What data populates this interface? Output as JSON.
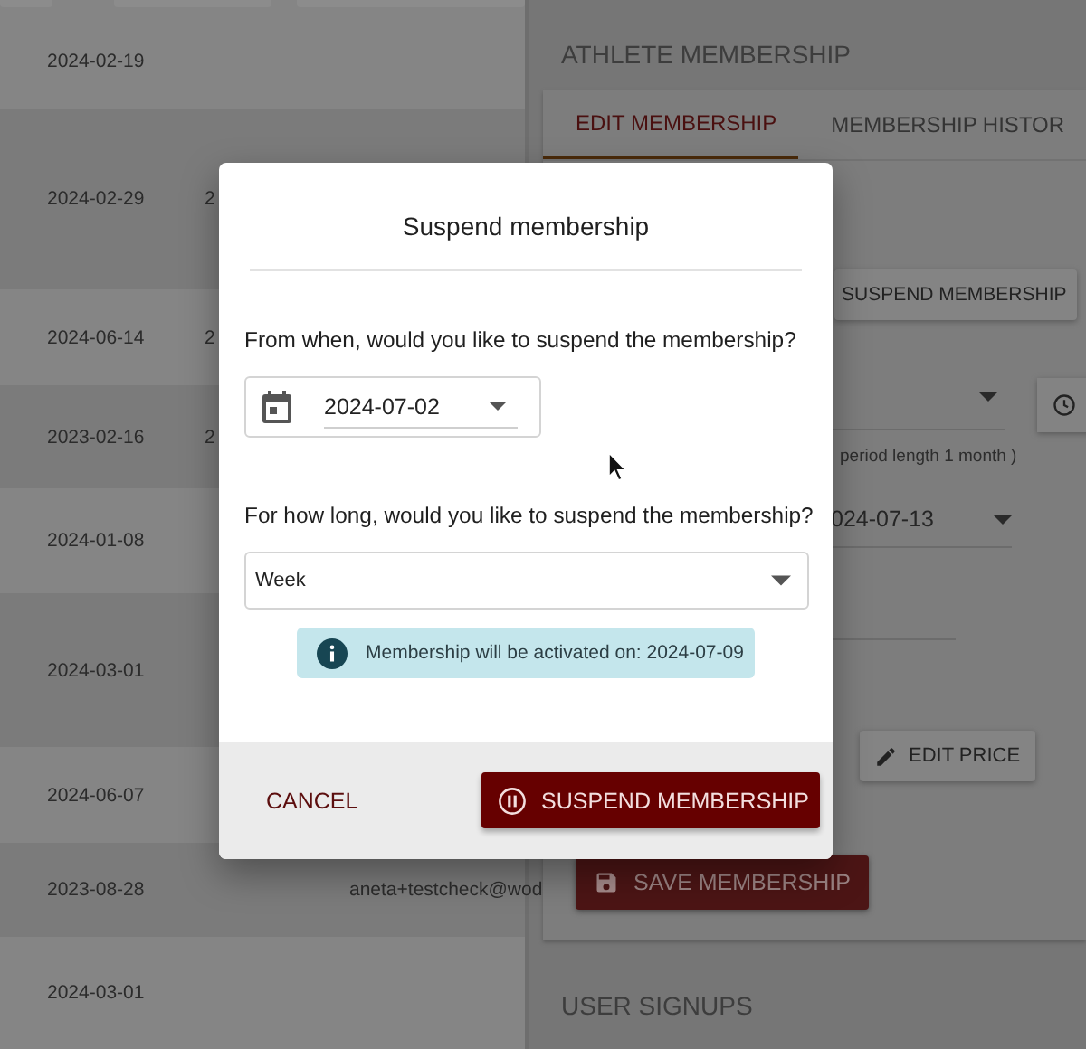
{
  "table": {
    "rows": [
      {
        "column_1": "2024-02-19"
      },
      {
        "column_1": "2024-02-29",
        "column_2": "2"
      },
      {
        "column_1": "2024-06-14",
        "column_2": "2"
      },
      {
        "column_1": "2023-02-16",
        "column_2": "2"
      },
      {
        "column_1": "2024-01-08"
      },
      {
        "column_1": "2024-03-01"
      },
      {
        "column_1": "2024-06-07"
      },
      {
        "column_1": "2023-08-28",
        "column_3": "aneta+testcheck@wod"
      },
      {
        "column_1": "2024-03-01"
      }
    ]
  },
  "panel": {
    "title": "ATHLETE MEMBERSHIP",
    "tabs": [
      {
        "label": "EDIT MEMBERSHIP",
        "selected": true
      },
      {
        "label": "MEMBERSHIP HISTOR",
        "selected": false
      }
    ],
    "suspend_button": "SUSPEND MEMBERSHIP",
    "period_hint": "period length 1 month )",
    "end_date": "024-07-13",
    "edit_price_button": "EDIT PRICE",
    "save_button": "SAVE MEMBERSHIP",
    "section_title": "USER SIGNUPS"
  },
  "dialog": {
    "title": "Suspend membership",
    "start_question": "From when, would you like to suspend the membership?",
    "start_date": "2024-07-02",
    "duration_question": "For how long, would you like to suspend the membership?",
    "duration": "Week",
    "info": "Membership will be activated on: 2024-07-09",
    "buttons": [
      {
        "label": "CANCEL",
        "kind": "text"
      },
      {
        "label": "SUSPEND MEMBERSHIP",
        "kind": "primary"
      }
    ]
  }
}
